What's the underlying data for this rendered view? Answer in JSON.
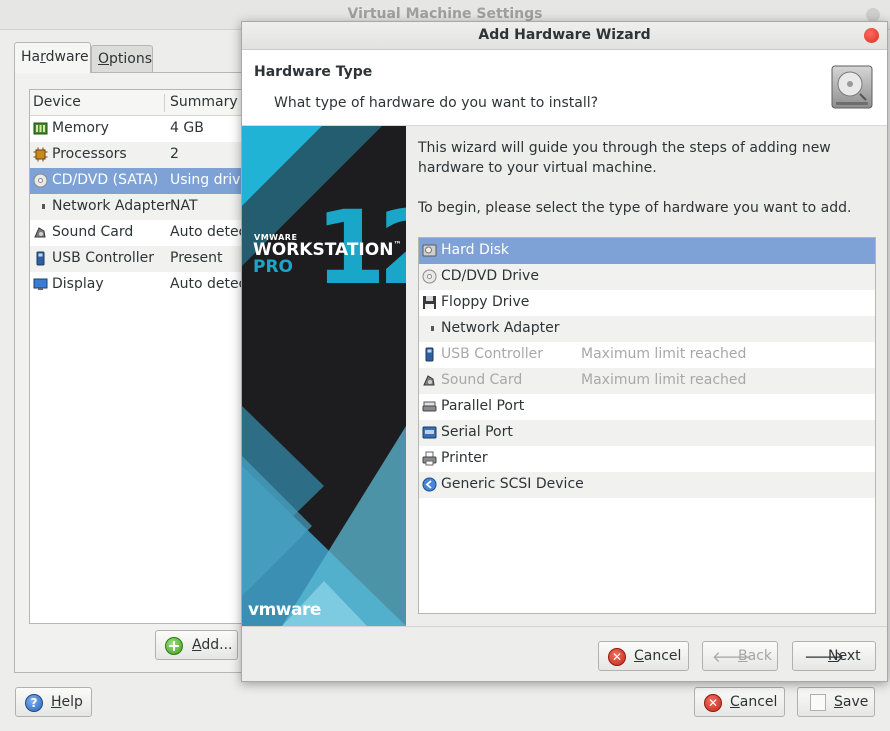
{
  "settings_window": {
    "title": "Virtual Machine Settings",
    "tabs": [
      {
        "label_pre": "Ha",
        "label_mnemonic": "r",
        "label_post": "dware"
      },
      {
        "label_mnemonic": "O",
        "label_post": "ptions"
      }
    ],
    "columns": {
      "device": "Device",
      "summary": "Summary"
    },
    "devices": [
      {
        "name": "Memory",
        "summary": "4 GB",
        "icon": "memory-icon"
      },
      {
        "name": "Processors",
        "summary": "2",
        "icon": "processor-icon"
      },
      {
        "name": "CD/DVD (SATA)",
        "summary": "Using drive",
        "icon": "cd-dvd-icon"
      },
      {
        "name": "Network Adapter",
        "summary": "NAT",
        "icon": "network-adapter-icon"
      },
      {
        "name": "Sound Card",
        "summary": "Auto detect",
        "icon": "sound-card-icon"
      },
      {
        "name": "USB Controller",
        "summary": "Present",
        "icon": "usb-controller-icon"
      },
      {
        "name": "Display",
        "summary": "Auto detect",
        "icon": "display-icon"
      }
    ],
    "add_button": {
      "mnemonic": "A",
      "rest": "dd..."
    },
    "help_button": {
      "mnemonic": "H",
      "rest": "elp"
    },
    "cancel_button": {
      "mnemonic": "C",
      "rest": "ancel"
    },
    "save_button": {
      "mnemonic": "S",
      "rest": "ave"
    }
  },
  "wizard": {
    "title": "Add Hardware Wizard",
    "header_title": "Hardware Type",
    "header_subtitle": "What type of hardware do you want to install?",
    "intro_text": "This wizard will guide you through the steps of adding new hardware to your virtual machine.",
    "instruction_text": "To begin, please select the type of hardware you want to add.",
    "banner": {
      "brand_small": "VMWARE",
      "product": "WORKSTATION",
      "product_mark": "™",
      "edition": "PRO",
      "version": "12",
      "logo": "vmware"
    },
    "hardware_types": [
      {
        "name": "Hard Disk",
        "note": "",
        "icon": "hard-disk-icon",
        "selected": true,
        "disabled": false
      },
      {
        "name": "CD/DVD Drive",
        "note": "",
        "icon": "cd-dvd-icon",
        "selected": false,
        "disabled": false
      },
      {
        "name": "Floppy Drive",
        "note": "",
        "icon": "floppy-icon",
        "selected": false,
        "disabled": false
      },
      {
        "name": "Network Adapter",
        "note": "",
        "icon": "network-adapter-icon",
        "selected": false,
        "disabled": false
      },
      {
        "name": "USB Controller",
        "note": "Maximum limit reached",
        "icon": "usb-controller-icon",
        "selected": false,
        "disabled": true
      },
      {
        "name": "Sound Card",
        "note": "Maximum limit reached",
        "icon": "sound-card-icon",
        "selected": false,
        "disabled": true
      },
      {
        "name": "Parallel Port",
        "note": "",
        "icon": "parallel-port-icon",
        "selected": false,
        "disabled": false
      },
      {
        "name": "Serial Port",
        "note": "",
        "icon": "serial-port-icon",
        "selected": false,
        "disabled": false
      },
      {
        "name": "Printer",
        "note": "",
        "icon": "printer-icon",
        "selected": false,
        "disabled": false
      },
      {
        "name": "Generic SCSI Device",
        "note": "",
        "icon": "scsi-device-icon",
        "selected": false,
        "disabled": false
      }
    ],
    "cancel_button": {
      "mnemonic": "C",
      "rest": "ancel"
    },
    "back_button": {
      "mnemonic": "B",
      "rest": "ack"
    },
    "next_button": {
      "mnemonic": "N",
      "rest": "ext"
    }
  },
  "colors": {
    "selection": "#7ea2d6",
    "banner_dark": "#1d1d1f",
    "banner_teal": "#1aa6c8",
    "close_red": "#d92e1f"
  }
}
